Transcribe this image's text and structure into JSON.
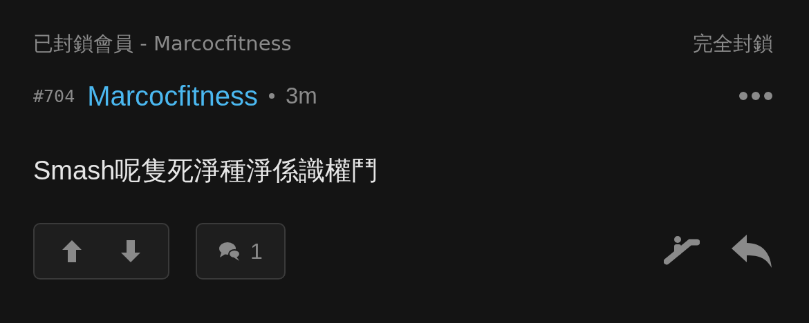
{
  "header": {
    "title": "已封鎖會員 - Marcocfitness",
    "action": "完全封鎖"
  },
  "post": {
    "number": "#704",
    "author": "Marcocfitness",
    "time": "3m",
    "body": "Smash呢隻死淨種淨係識權鬥"
  },
  "footer": {
    "comment_count": "1"
  }
}
